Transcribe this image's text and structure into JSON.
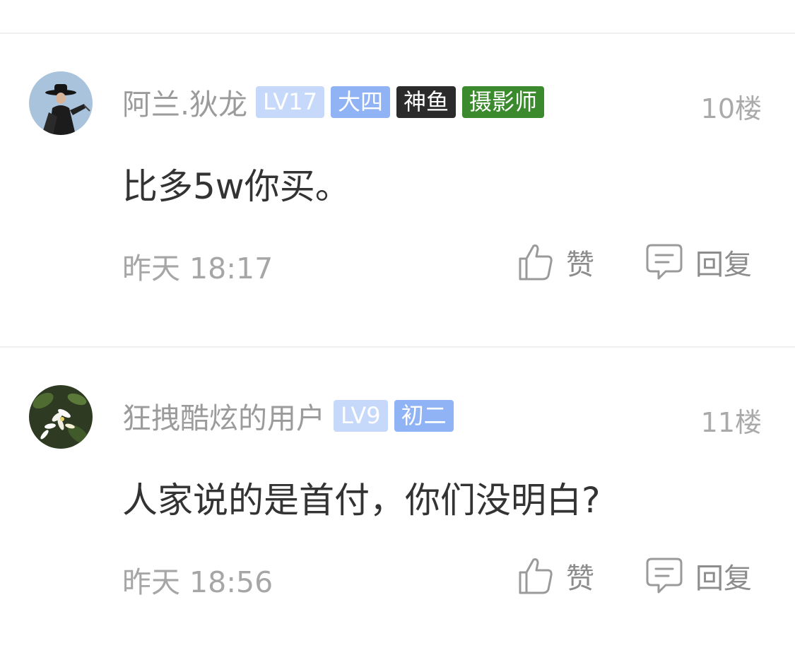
{
  "comments": [
    {
      "username": "阿兰.狄龙",
      "badges": [
        {
          "text": "LV17",
          "bg": "#c7d9fb",
          "color": "#ffffff"
        },
        {
          "text": "大四",
          "bg": "#8fb3f5",
          "color": "#ffffff"
        },
        {
          "text": "神鱼",
          "bg": "#2b2b2b",
          "color": "#ffffff"
        },
        {
          "text": "摄影师",
          "bg": "#3c8a2e",
          "color": "#ffffff"
        }
      ],
      "floor": "10楼",
      "content": "比多5w你买。",
      "time": "昨天 18:17",
      "like_label": "赞",
      "reply_label": "回复",
      "avatar_icon": "avatar-person-in-black-hat"
    },
    {
      "username": "狂拽酷炫的用户",
      "badges": [
        {
          "text": "LV9",
          "bg": "#c7d9fb",
          "color": "#ffffff"
        },
        {
          "text": "初二",
          "bg": "#8fb3f5",
          "color": "#ffffff"
        }
      ],
      "floor": "11楼",
      "content": "人家说的是首付，你们没明白?",
      "time": "昨天 18:56",
      "like_label": "赞",
      "reply_label": "回复",
      "avatar_icon": "avatar-white-flowers"
    }
  ],
  "colors": {
    "username": "#9b9b9b",
    "content": "#333333",
    "meta": "#a6a6a6",
    "divider": "#f0f0f0"
  },
  "icons": {
    "like": "thumbs-up-icon",
    "reply": "chat-bubble-icon"
  }
}
